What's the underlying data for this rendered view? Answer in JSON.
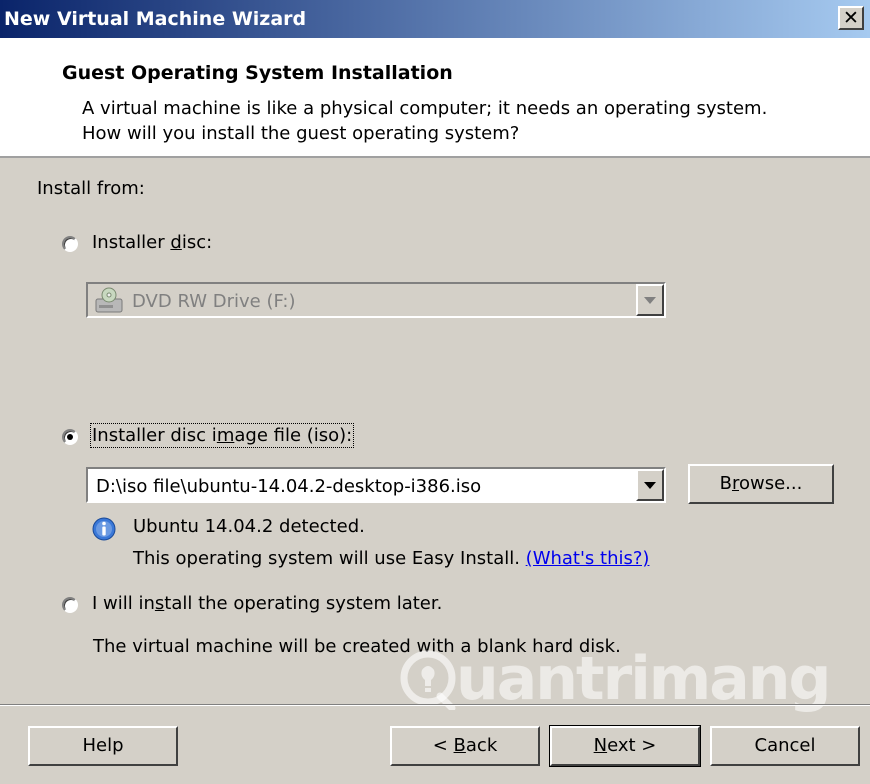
{
  "window": {
    "title": "New Virtual Machine Wizard",
    "close_glyph": "✕"
  },
  "header": {
    "title": "Guest Operating System Installation",
    "description": "A virtual machine is like a physical computer; it needs an operating system. How will you install the guest operating system?"
  },
  "install_from": {
    "label": "Install from:"
  },
  "options": {
    "installer_disc": {
      "label_pre": "Installer ",
      "label_mnemonic": "d",
      "label_post": "isc:",
      "selected": false,
      "drive": {
        "value": "DVD RW Drive (F:)",
        "icon": "dvd-drive-icon",
        "enabled": false
      }
    },
    "iso_image": {
      "label_pre": "Installer disc i",
      "label_mnemonic": "m",
      "label_post": "age file (iso):",
      "selected": true,
      "path": "D:\\iso file\\ubuntu-14.04.2-desktop-i386.iso",
      "browse_pre": "B",
      "browse_mnemonic": "r",
      "browse_post": "owse...",
      "detected": "Ubuntu 14.04.2 detected.",
      "easy_install_note": "This operating system will use Easy Install. ",
      "whats_this_link": "(What's this?)",
      "info_icon": "info-icon"
    },
    "install_later": {
      "label_pre": "I will in",
      "label_mnemonic": "s",
      "label_post": "tall the operating system later.",
      "selected": false,
      "description": "The virtual machine will be created with a blank hard disk."
    }
  },
  "footer": {
    "help": "Help",
    "back_pre": "< ",
    "back_mnemonic": "B",
    "back_post": "ack",
    "next_mnemonic": "N",
    "next_post": "ext >",
    "cancel": "Cancel"
  },
  "watermark": {
    "text": "uantrimang"
  },
  "colors": {
    "titlebar_start": "#0a246a",
    "titlebar_end": "#a6caf0",
    "face": "#d4d0c8",
    "link": "#0000ee"
  }
}
